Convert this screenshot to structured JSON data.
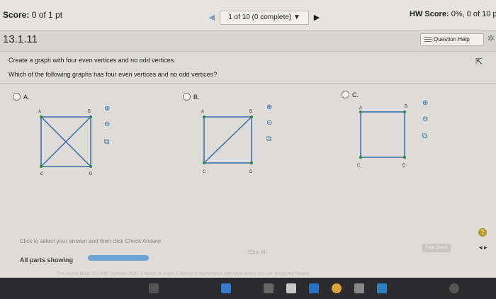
{
  "header": {
    "score_label": "Score:",
    "score_value": "0 of 1 pt",
    "nav_text": "1 of 10 (0 complete)",
    "nav_dropdown_glyph": "▼",
    "hw_label": "HW Score:",
    "hw_value": "0%, 0 of 10 p"
  },
  "question": {
    "id": "13.1.11",
    "help_label": "Question Help",
    "prompt": "Create a graph with four even vertices and no odd vertices.",
    "text": "Which of the following graphs has four even vertices and no odd vertices?"
  },
  "options": [
    {
      "label": "A.",
      "vertices": [
        "A",
        "B",
        "C",
        "D"
      ]
    },
    {
      "label": "B.",
      "vertices": [
        "A",
        "B",
        "C",
        "D"
      ]
    },
    {
      "label": "C.",
      "vertices": [
        "A",
        "B",
        "C",
        "D"
      ]
    }
  ],
  "icons": {
    "zoom_in": "magnifier-plus-icon",
    "zoom_out": "magnifier-minus-icon",
    "popout": "popout-icon",
    "gear": "gear-icon",
    "help": "question-help-icon"
  },
  "bottom": {
    "instruction": "Click to select your answer and then click Check Answer.",
    "all_parts": "All parts showing",
    "progress_fraction": 1.0,
    "clear_all": "Clear All",
    "check_answer": "Final Check",
    "help_q": "?",
    "footer": "This course (Math 101 4601 Summer 2020) is based on Angel: A Survey of Mathematics with Applications, 10e with Integrated Review"
  },
  "colors": {
    "accent": "#6aa4d4",
    "graph_edge": "#3a6aa8",
    "vertex": "#2a8a3a"
  }
}
